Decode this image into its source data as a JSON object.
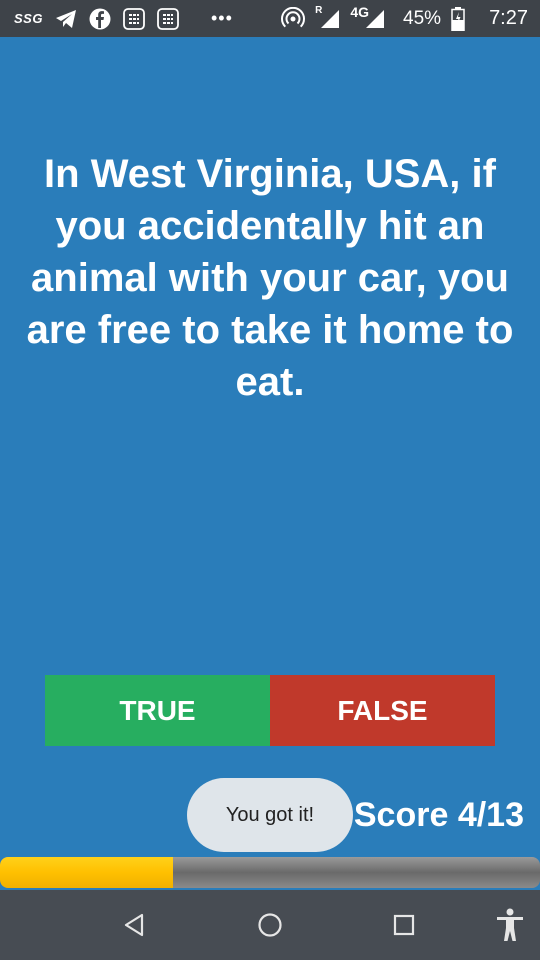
{
  "status_bar": {
    "carrier_label": "SSG",
    "network_roaming": "R",
    "network_type": "4G",
    "battery": "45%",
    "time": "7:27",
    "icons": [
      "telegram-icon",
      "facebook-icon",
      "app-grid-icon",
      "app-grid-icon",
      "more-dots-icon",
      "hotspot-icon",
      "signal-icon",
      "signal-icon",
      "battery-icon"
    ]
  },
  "quiz": {
    "question": "In West Virginia, USA, if you accidentally hit an animal with your car, you are free to take it home to eat.",
    "true_label": "TRUE",
    "false_label": "FALSE",
    "score_label": "Score 4/13",
    "toast": "You got it!",
    "progress": 0.32
  },
  "colors": {
    "background": "#2a7dba",
    "true_button": "#27ae60",
    "false_button": "#c0392b",
    "progress_fill": "#ffc000"
  },
  "nav_bar": {
    "icons": [
      "back-icon",
      "home-icon",
      "recents-icon",
      "accessibility-icon"
    ]
  }
}
